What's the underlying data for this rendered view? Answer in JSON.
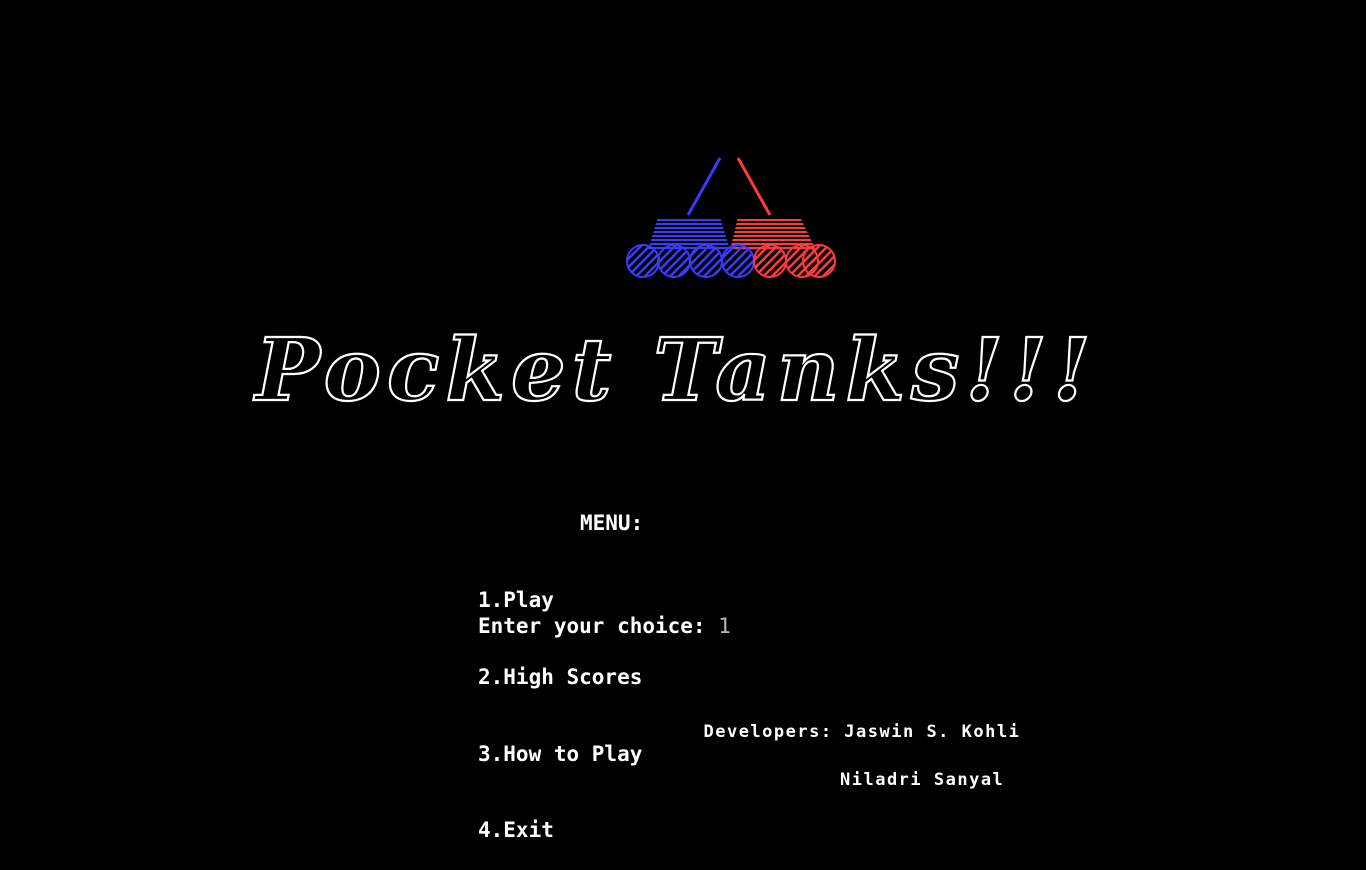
{
  "game": {
    "title": "Pocket Tanks!!!",
    "logo_icon": "two-tanks-logo",
    "colors": {
      "background": "#000000",
      "text": "#ffffff",
      "tank_blue": "#3a3aff",
      "tank_red": "#ff3a3a"
    }
  },
  "menu": {
    "heading": "MENU:",
    "items": [
      "1.Play",
      "2.High Scores",
      "3.How to Play",
      "4.Exit"
    ]
  },
  "prompt": {
    "label": "Enter your choice: ",
    "value": "1"
  },
  "credits": {
    "line1": "Developers: Jaswin S. Kohli",
    "line2": "Niladri Sanyal"
  }
}
